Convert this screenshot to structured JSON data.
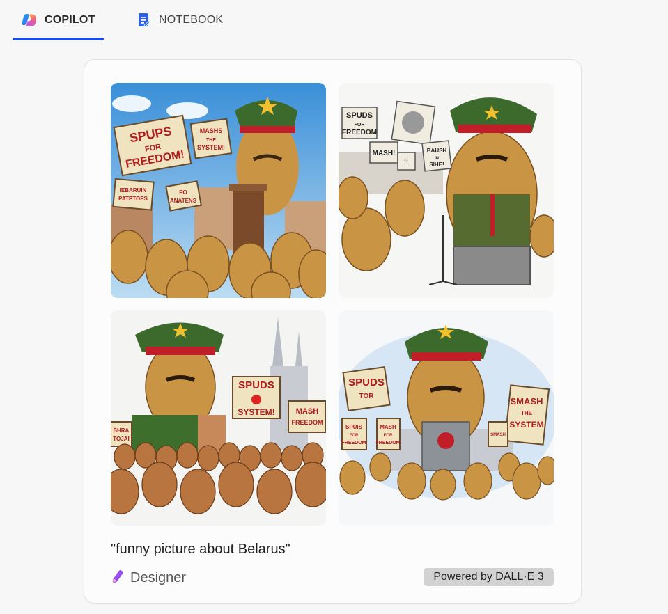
{
  "tabs": [
    {
      "label": "COPILOT",
      "icon": "copilot-logo-icon",
      "active": true
    },
    {
      "label": "NOTEBOOK",
      "icon": "notebook-icon",
      "active": false
    }
  ],
  "colors": {
    "active_tab_underline": "#1c4bd9",
    "card_background": "#fcfcfc",
    "badge_background": "#d2d2d2"
  },
  "images": [
    {
      "signs": [
        "SPUPS",
        "FOR",
        "FREEDOM!",
        "MASHS",
        "THE",
        "SYSTEM!",
        "IEBARUIN",
        "PATPTOPS",
        "PO",
        "ANATENS"
      ]
    },
    {
      "signs": [
        "SPUDS",
        "FOR",
        "FREEDOM",
        "MASH!",
        "!!",
        "BAUSH",
        "IN",
        "SIHE!"
      ]
    },
    {
      "signs": [
        "SPUDS",
        "SYSTEM!",
        "MASH",
        "FREEDOM",
        "SHRA",
        "TOJAI"
      ]
    },
    {
      "signs": [
        "SPUDS",
        "TOR",
        "SPUIS",
        "FOR",
        "FREEDOM",
        "MASH",
        "FOR",
        "FREEDOM",
        "SMASH",
        "THE",
        "SYSTEM",
        "SMASH"
      ]
    }
  ],
  "prompt": "\"funny picture about Belarus\"",
  "designer": {
    "label": "Designer",
    "icon": "designer-logo-icon"
  },
  "badge": "Powered by DALL·E 3"
}
